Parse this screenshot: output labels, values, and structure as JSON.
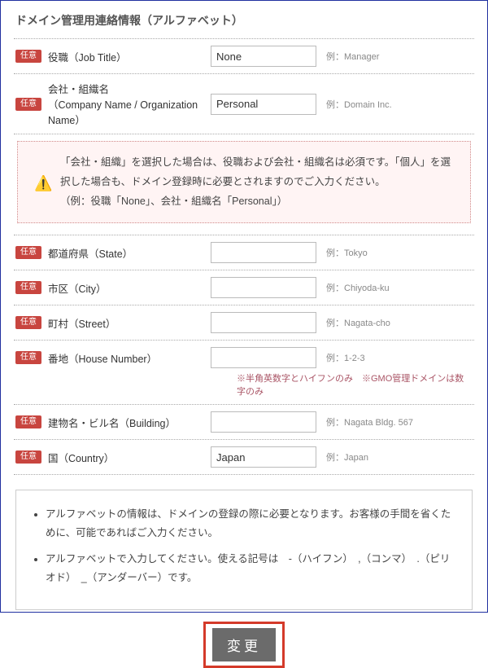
{
  "section_title": "ドメイン管理用連絡情報（アルファベット）",
  "badge_text": "任意",
  "fields": {
    "job_title": {
      "label": "役職（Job Title）",
      "value": "None",
      "example": "例：Manager"
    },
    "company": {
      "label1": "会社・組織名",
      "label2": "（Company Name / Organization Name）",
      "value": "Personal",
      "example": "例：Domain Inc."
    },
    "state": {
      "label": "都道府県（State）",
      "value": "",
      "example": "例：Tokyo"
    },
    "city": {
      "label": "市区（City）",
      "value": "",
      "example": "例：Chiyoda-ku"
    },
    "street": {
      "label": "町村（Street）",
      "value": "",
      "example": "例：Nagata-cho"
    },
    "house": {
      "label": "番地（House Number）",
      "value": "",
      "example": "例：1-2-3",
      "note": "※半角英数字とハイフンのみ　※GMO管理ドメインは数字のみ"
    },
    "building": {
      "label": "建物名・ビル名（Building）",
      "value": "",
      "example": "例：Nagata Bldg. 567"
    },
    "country": {
      "label": "国（Country）",
      "value": "Japan",
      "example": "例：Japan"
    }
  },
  "warning": {
    "line1": "「会社・組織」を選択した場合は、役職および会社・組織名は必須です。「個人」を選択した場合も、ドメイン登録時に必要とされますのでご入力ください。",
    "line2": "（例：役職「None」、会社・組織名「Personal」）"
  },
  "notes": {
    "li1": "アルファベットの情報は、ドメインの登録の際に必要となります。お客様の手間を省くために、可能であればご入力ください。",
    "li2": "アルファベットで入力してください。使える記号は　-（ハイフン）　,（コンマ）　.（ピリオド）　_（アンダーバー）です。"
  },
  "submit_label": "変更"
}
